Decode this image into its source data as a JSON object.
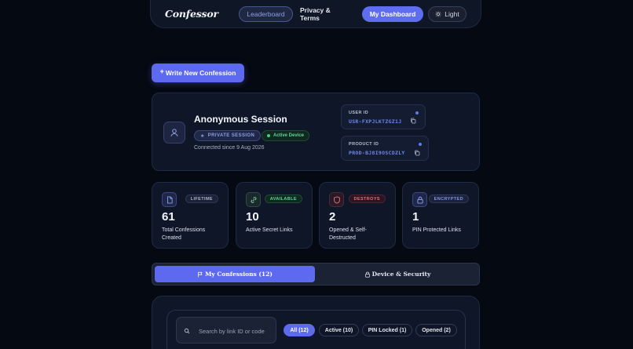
{
  "nav": {
    "brand": "Confessor",
    "leaderboard": "Leaderboard",
    "privacy": "Privacy & Terms",
    "dashboard": "My Dashboard",
    "theme": "Light"
  },
  "write_button": {
    "label": "Write New Confession",
    "plus": "+"
  },
  "session": {
    "title": "Anonymous Session",
    "private_badge": "PRIVATE SESSION",
    "active_badge": "Active Device",
    "connected": "Connected since 9 Aug 2026",
    "user_id_label": "USER ID",
    "user_id_value": "USR-FXPJLKTZGZ1J",
    "product_id_label": "PRODUCT ID",
    "product_id_value": "PROD-BJ8I9OSCDZLY"
  },
  "stats": [
    {
      "badge": "LIFETIME",
      "value": "61",
      "label": "Total Confessions Created",
      "icon": "file-icon"
    },
    {
      "badge": "AVAILABLE",
      "value": "10",
      "label": "Active Secret Links",
      "icon": "link-icon"
    },
    {
      "badge": "DESTROYS",
      "value": "2",
      "label": "Opened & Self-Destructed",
      "icon": "shield-icon"
    },
    {
      "badge": "ENCRYPTED",
      "value": "1",
      "label": "PIN Protected Links",
      "icon": "lock-icon"
    }
  ],
  "colors": {
    "accent": "#5d6af0",
    "lifetime": "#6f86e6",
    "available": "#5fd39a",
    "destroys": "#e8707e",
    "encrypted": "#7f98e8"
  },
  "tabs": {
    "confessions": "My Confessions (12)",
    "security": "Device & Security"
  },
  "filters": {
    "search_placeholder": "Search by link ID or code",
    "all": "All (12)",
    "active": "Active (10)",
    "pin_locked": "PIN Locked (1)",
    "opened": "Opened (2)"
  }
}
